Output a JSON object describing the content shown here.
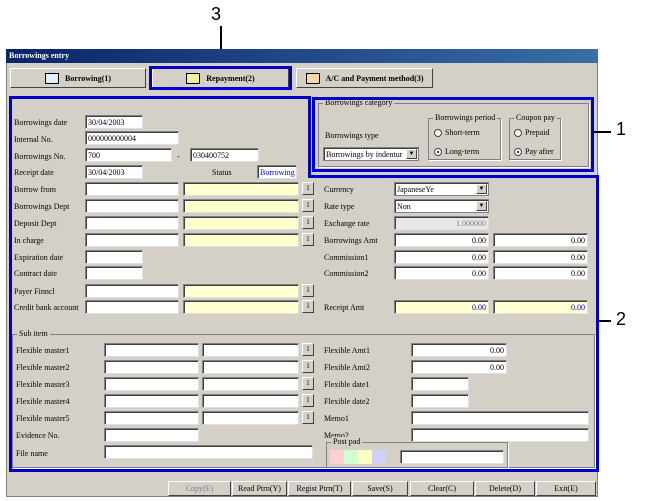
{
  "window_title": "Borrowings entry",
  "tabs": [
    {
      "label": "Borrowing(1)"
    },
    {
      "label": "Repayment(2)"
    },
    {
      "label": "A/C and Payment method(3)"
    }
  ],
  "callouts": [
    "1",
    "2",
    "3"
  ],
  "header": {
    "borrowings_date_label": "Borrowings date",
    "borrowings_date": "30/04/2003",
    "internal_no_label": "Internal No.",
    "internal_no": "000000000004",
    "borrowings_no_label": "Borrowings No.",
    "borrowings_no_a": "700",
    "borrowings_no_dash": "-",
    "borrowings_no_b": "030400752",
    "receipt_date_label": "Receipt date",
    "receipt_date": "30/04/2003",
    "status_label": "Status",
    "status_value": "Borrowing"
  },
  "category": {
    "title": "Borrowings category",
    "type_label": "Borrowings type",
    "type_value": "Borrowings by indentur",
    "period_title": "Borrowings period",
    "short_term": "Short-term",
    "long_term": "Long-term",
    "coupon_title": "Coupon pay",
    "prepaid": "Prepaid",
    "pay_after": "Pay after"
  },
  "left_fields": [
    {
      "label": "Borrow from"
    },
    {
      "label": "Borrowings Dept"
    },
    {
      "label": "Deposit Dept"
    },
    {
      "label": "In charge"
    },
    {
      "label": "Expiration date"
    },
    {
      "label": "Contract date"
    },
    {
      "label": "Payer Finncl"
    },
    {
      "label": "Credit bank account"
    }
  ],
  "lookup_button": "1",
  "right_fields": {
    "currency_label": "Currency",
    "currency_value": "JapaneseYe",
    "rate_type_label": "Rate type",
    "rate_type_value": "Non",
    "exchange_rate_label": "Exchange rate",
    "exchange_rate_value": "1.000000",
    "borrowings_amt_label": "Borrowings Amt",
    "borrowings_amt_a": "0.00",
    "borrowings_amt_b": "0.00",
    "commission1_label": "Commission1",
    "commission1_a": "0.00",
    "commission1_b": "0.00",
    "commission2_label": "Commission2",
    "commission2_a": "0.00",
    "commission2_b": "0.00",
    "receipt_amt_label": "Receipt Amt",
    "receipt_amt_a": "0.00",
    "receipt_amt_b": "0.00"
  },
  "sub_item": {
    "title": "Sub item",
    "masters": [
      {
        "label": "Flexible master1"
      },
      {
        "label": "Flexible master2"
      },
      {
        "label": "Flexible master3"
      },
      {
        "label": "Flexible master4"
      },
      {
        "label": "Flexible master5"
      }
    ],
    "evidence_no_label": "Evidence No.",
    "file_name_label": "File name",
    "flexible_amt1_label": "Flexible Amt1",
    "flexible_amt1": "0.00",
    "flexible_amt2_label": "Flexible Amt2",
    "flexible_amt2": "0.00",
    "flexible_date1_label": "Flexible date1",
    "flexible_date2_label": "Flexible date2",
    "memo1_label": "Memo1",
    "memo2_label": "Memo2",
    "post_pad_label": "Post pad",
    "post_pad_colors": [
      "#ffd0d0",
      "#d0ffd0",
      "#ffffc0",
      "#d0d0ff"
    ]
  },
  "buttons": {
    "copy": "Copy(E)",
    "read_ptrn": "Read Ptrn(Y)",
    "regist_ptrn": "Regist Ptrn(T)",
    "save": "Save(S)",
    "clear": "Clear(C)",
    "delete": "Delete(D)",
    "exit": "Exit(E)"
  }
}
